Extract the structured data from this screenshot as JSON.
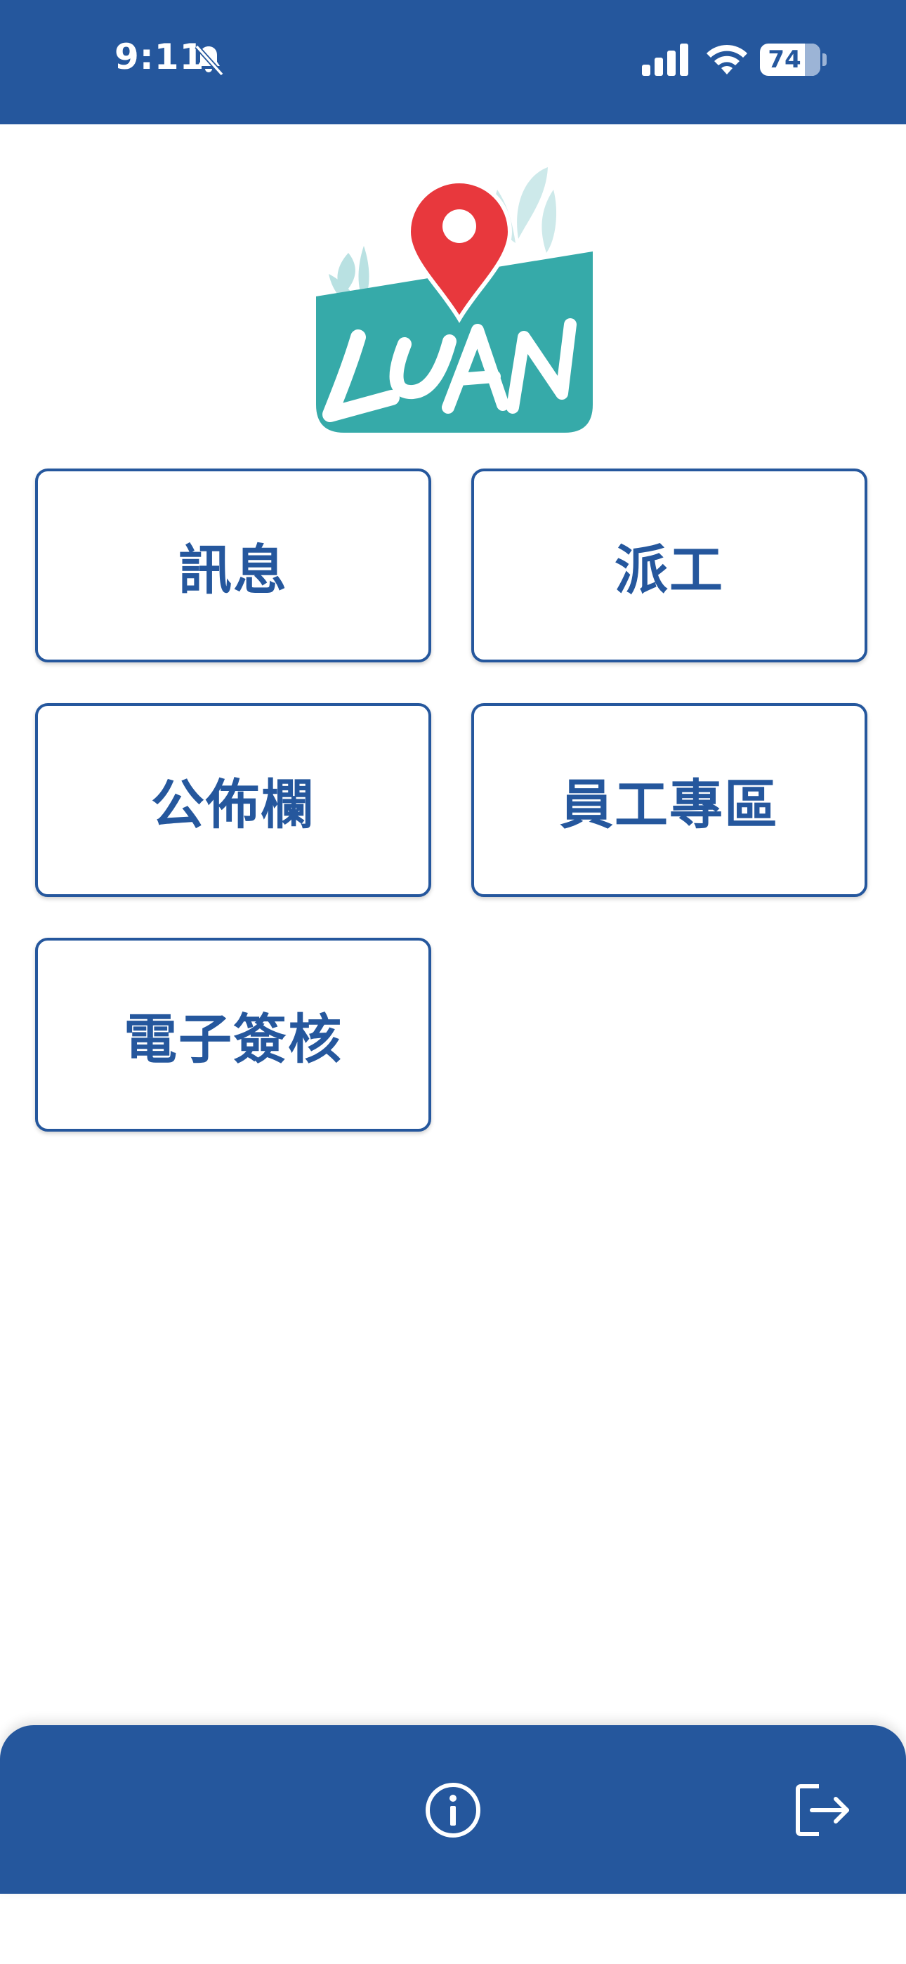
{
  "status_bar": {
    "time": "9:11",
    "battery": "74",
    "icons": [
      "bell-slash-icon",
      "cellular-signal-icon",
      "wifi-icon",
      "battery-icon"
    ]
  },
  "logo": {
    "text": "LUAN"
  },
  "menu": {
    "items": [
      {
        "label": "訊息"
      },
      {
        "label": "派工"
      },
      {
        "label": "公佈欄"
      },
      {
        "label": "員工專區"
      },
      {
        "label": "電子簽核"
      }
    ]
  },
  "bottom_bar": {
    "icons": [
      "info-icon",
      "logout-icon"
    ]
  },
  "colors": {
    "primary": "#25579d",
    "logo_teal": "#36aaa9",
    "pin_red": "#e8383d",
    "background": "#ffffff"
  }
}
